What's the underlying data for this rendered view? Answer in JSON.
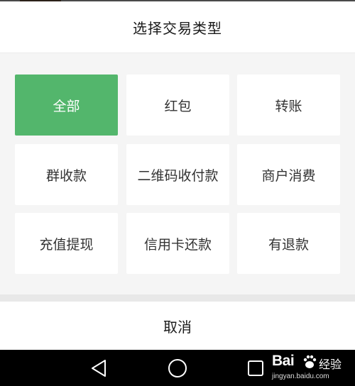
{
  "sheet": {
    "title": "选择交易类型",
    "options": [
      {
        "label": "全部",
        "selected": true
      },
      {
        "label": "红包",
        "selected": false
      },
      {
        "label": "转账",
        "selected": false
      },
      {
        "label": "群收款",
        "selected": false
      },
      {
        "label": "二维码收付款",
        "selected": false
      },
      {
        "label": "商户消费",
        "selected": false
      },
      {
        "label": "充值提现",
        "selected": false
      },
      {
        "label": "信用卡还款",
        "selected": false
      },
      {
        "label": "有退款",
        "selected": false
      }
    ],
    "cancel_label": "取消"
  },
  "navbar": {
    "icons": [
      "back-triangle-icon",
      "home-circle-icon",
      "recent-apps-square-icon"
    ]
  },
  "watermark": {
    "brand_left": "Bai",
    "brand_right": "经验",
    "url": "jingyan.baidu.com"
  },
  "colors": {
    "selected_option_bg": "#53b66c",
    "grid_bg": "#f5f5f5",
    "navbar_bg": "#000000"
  }
}
